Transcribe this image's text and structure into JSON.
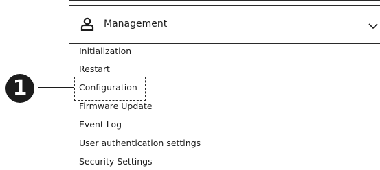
{
  "menu": {
    "header": {
      "icon": "person-icon",
      "title": "Management",
      "chevron": "chevron-down-icon"
    },
    "items": [
      {
        "label": "Initialization"
      },
      {
        "label": "Restart"
      },
      {
        "label": "Configuration"
      },
      {
        "label": "Firmware Update"
      },
      {
        "label": "Event Log"
      },
      {
        "label": "User authentication settings"
      },
      {
        "label": "Security Settings"
      }
    ]
  },
  "callout": {
    "number": "1",
    "target": "Configuration"
  }
}
